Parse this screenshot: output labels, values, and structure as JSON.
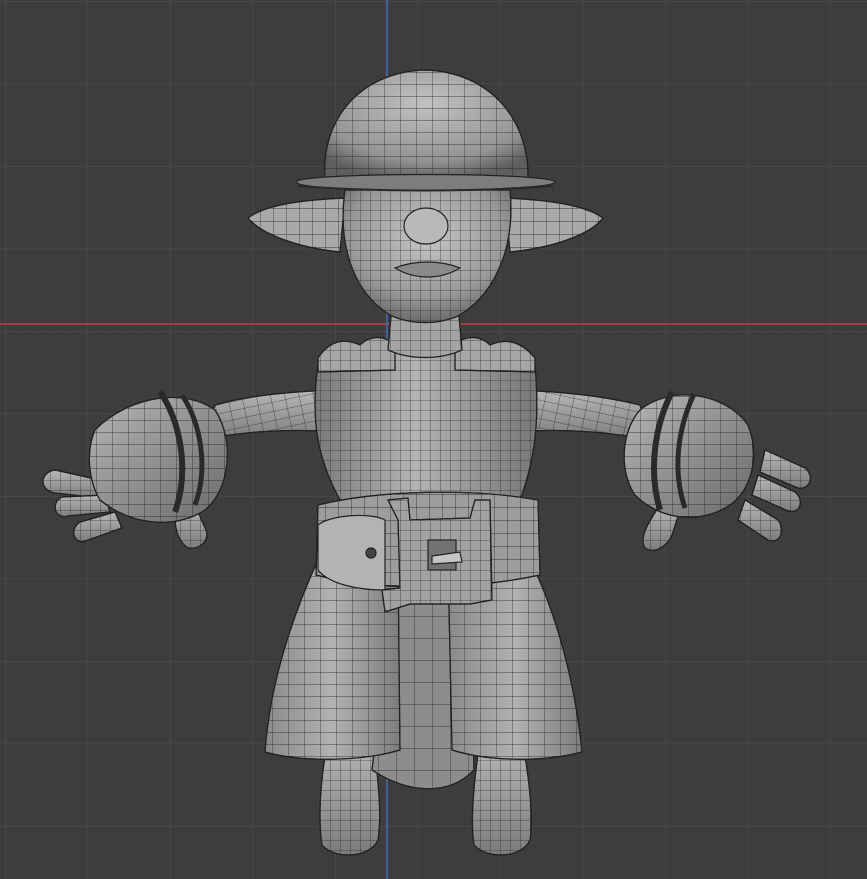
{
  "viewport": {
    "background": "#3d3d3d",
    "grid_minor_color": "#434343",
    "grid_major_color": "#4a4a4a",
    "x_axis_color": "#c8394a",
    "z_axis_color": "#3c73c6"
  },
  "model": {
    "shade_light": "#bcbcbc",
    "shade_mid": "#8e8e8e",
    "shade_dark": "#5a5a5a",
    "wire_color": "#1b1b1b"
  }
}
